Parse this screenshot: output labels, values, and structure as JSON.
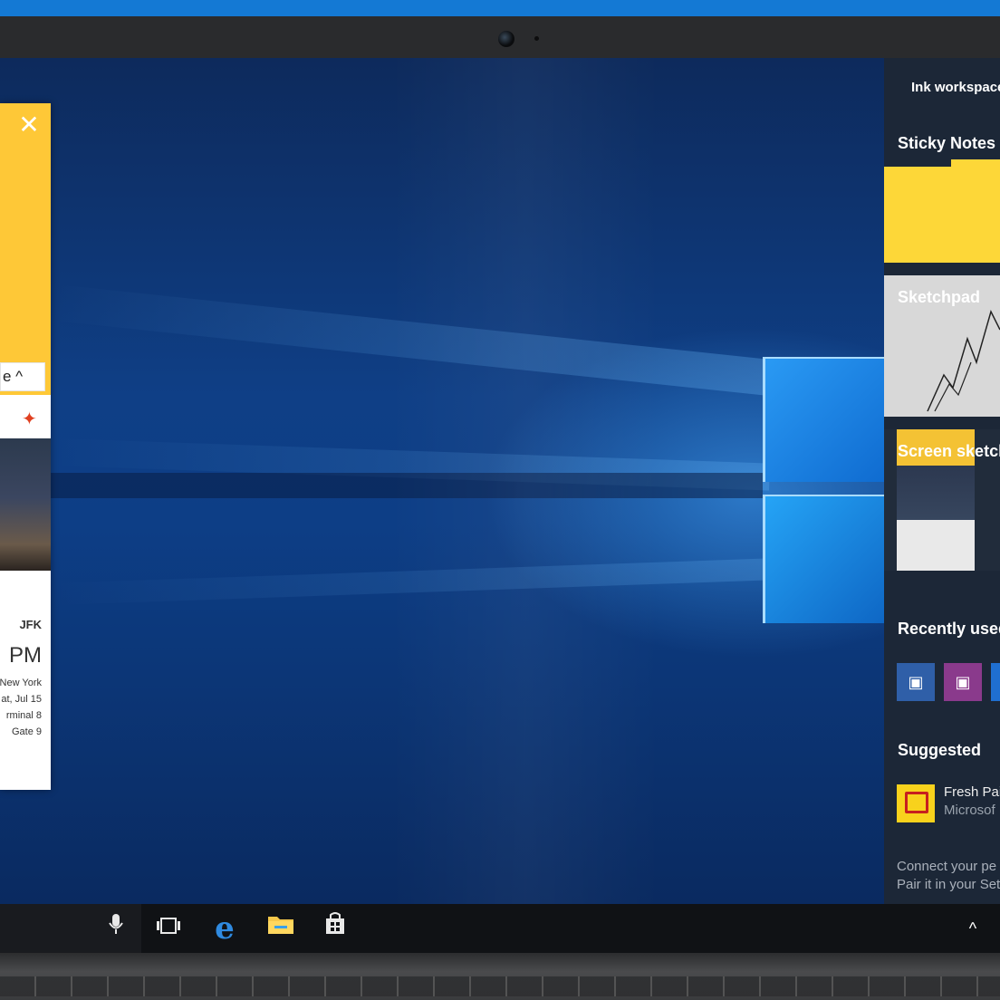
{
  "left_panel": {
    "close_glyph": "✕",
    "chip_label": "e ^",
    "flight_code": "JFK",
    "time_fragment": "PM",
    "city": "New York",
    "date": "at, Jul 15",
    "terminal": "rminal 8",
    "gate": "Gate 9"
  },
  "ink_workspace": {
    "title": "Ink workspace",
    "sticky_notes": "Sticky Notes",
    "sketchpad": "Sketchpad",
    "screen_sketch": "Screen sketch",
    "recently_used": "Recently used",
    "suggested": "Suggested",
    "suggested_app": {
      "name": "Fresh Pai",
      "publisher": "Microsof"
    },
    "footer_line1": "Connect your pe",
    "footer_line2": "Pair it in your Set",
    "recent_apps": [
      {
        "icon": "teams-like-app-icon",
        "color": "#2f5fa8"
      },
      {
        "icon": "onenote-like-app-icon",
        "color": "#8a3a8c"
      },
      {
        "icon": "blue-app-icon",
        "color": "#1f6fd0"
      }
    ]
  },
  "taskbar": {
    "icons": [
      "microphone-icon",
      "task-view-icon",
      "edge-icon",
      "file-explorer-icon",
      "store-icon"
    ],
    "tray_chevron": "^"
  },
  "colors": {
    "accent_blue": "#1479d4",
    "sticky_yellow": "#fdd738",
    "ink_panel_bg": "#1c2737"
  }
}
